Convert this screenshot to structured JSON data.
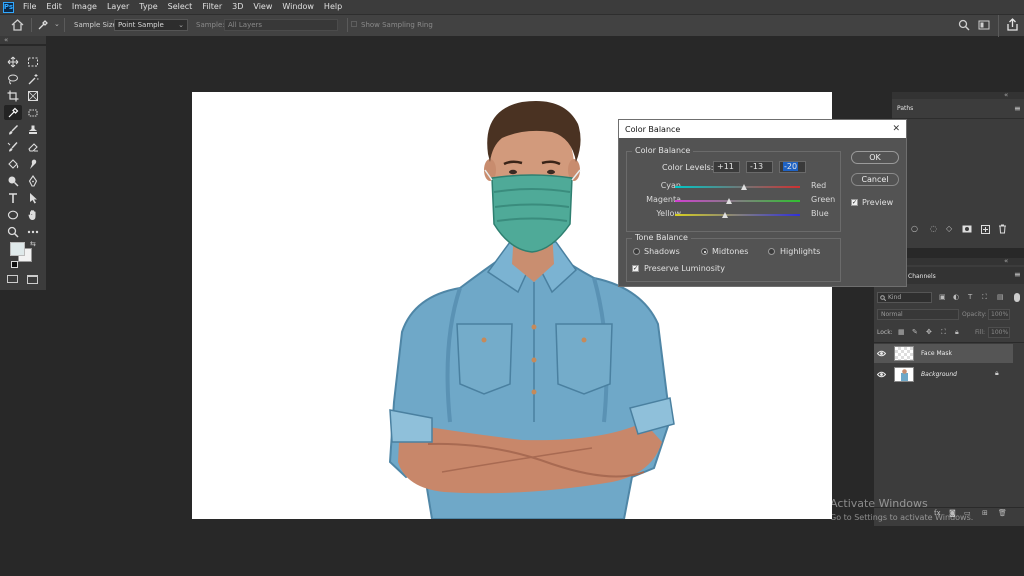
{
  "menubar": {
    "app_badge": "Ps",
    "items": [
      "File",
      "Edit",
      "Image",
      "Layer",
      "Type",
      "Select",
      "Filter",
      "3D",
      "View",
      "Window",
      "Help"
    ]
  },
  "options_bar": {
    "sample_size_label": "Sample Size:",
    "sample_size_value": "Point Sample",
    "sample_label": "Sample:",
    "sample_value": "All Layers",
    "show_sampling_ring_label": "Show Sampling Ring"
  },
  "toolbar": {
    "collapse_label": "«",
    "tools": [
      "move-icon",
      "marquee-icon",
      "lasso-icon",
      "magic-wand-icon",
      "crop-icon",
      "frame-icon",
      "eyedropper-icon",
      "patch-icon",
      "brush-icon",
      "stamp-icon",
      "history-brush-icon",
      "eraser-icon",
      "bucket-icon",
      "smudge-icon",
      "dodge-icon",
      "pen-icon",
      "type-icon",
      "path-select-icon",
      "ellipse-icon",
      "hand-icon",
      "zoom-icon",
      "more-icon"
    ]
  },
  "color_balance": {
    "title": "Color Balance",
    "close": "✕",
    "section_color_balance": "Color Balance",
    "color_levels_label": "Color Levels:",
    "levels": [
      "+11",
      "-13",
      "-20"
    ],
    "sliders": [
      {
        "left": "Cyan",
        "right": "Red",
        "value": 11,
        "gradient": [
          "#00c8c8",
          "#d03030"
        ]
      },
      {
        "left": "Magenta",
        "right": "Green",
        "value": -13,
        "gradient": [
          "#d040d0",
          "#30c030"
        ]
      },
      {
        "left": "Yellow",
        "right": "Blue",
        "value": -20,
        "gradient": [
          "#d8d020",
          "#3030d8"
        ]
      }
    ],
    "section_tone_balance": "Tone Balance",
    "tones": [
      "Shadows",
      "Midtones",
      "Highlights"
    ],
    "tone_selected": "Midtones",
    "preserve_luminosity_label": "Preserve Luminosity",
    "preserve_luminosity": true,
    "ok_label": "OK",
    "cancel_label": "Cancel",
    "preview_label": "Preview",
    "preview": true
  },
  "paths_panel": {
    "tab": "Paths",
    "collapse": "«",
    "menu": "≡"
  },
  "layers_panel": {
    "tab_channels": "Channels",
    "collapse": "«",
    "kind_placeholder": "Kind",
    "blend_mode": "Normal",
    "opacity_label": "Opacity:",
    "opacity_value": "100%",
    "lock_label": "Lock:",
    "fill_label": "Fill:",
    "fill_value": "100%",
    "layers": [
      {
        "name": "Face Mask",
        "italic": false
      },
      {
        "name": "Background",
        "italic": true
      }
    ]
  },
  "watermark": {
    "line1": "Activate Windows",
    "line2": "Go to Settings to activate Windows."
  }
}
